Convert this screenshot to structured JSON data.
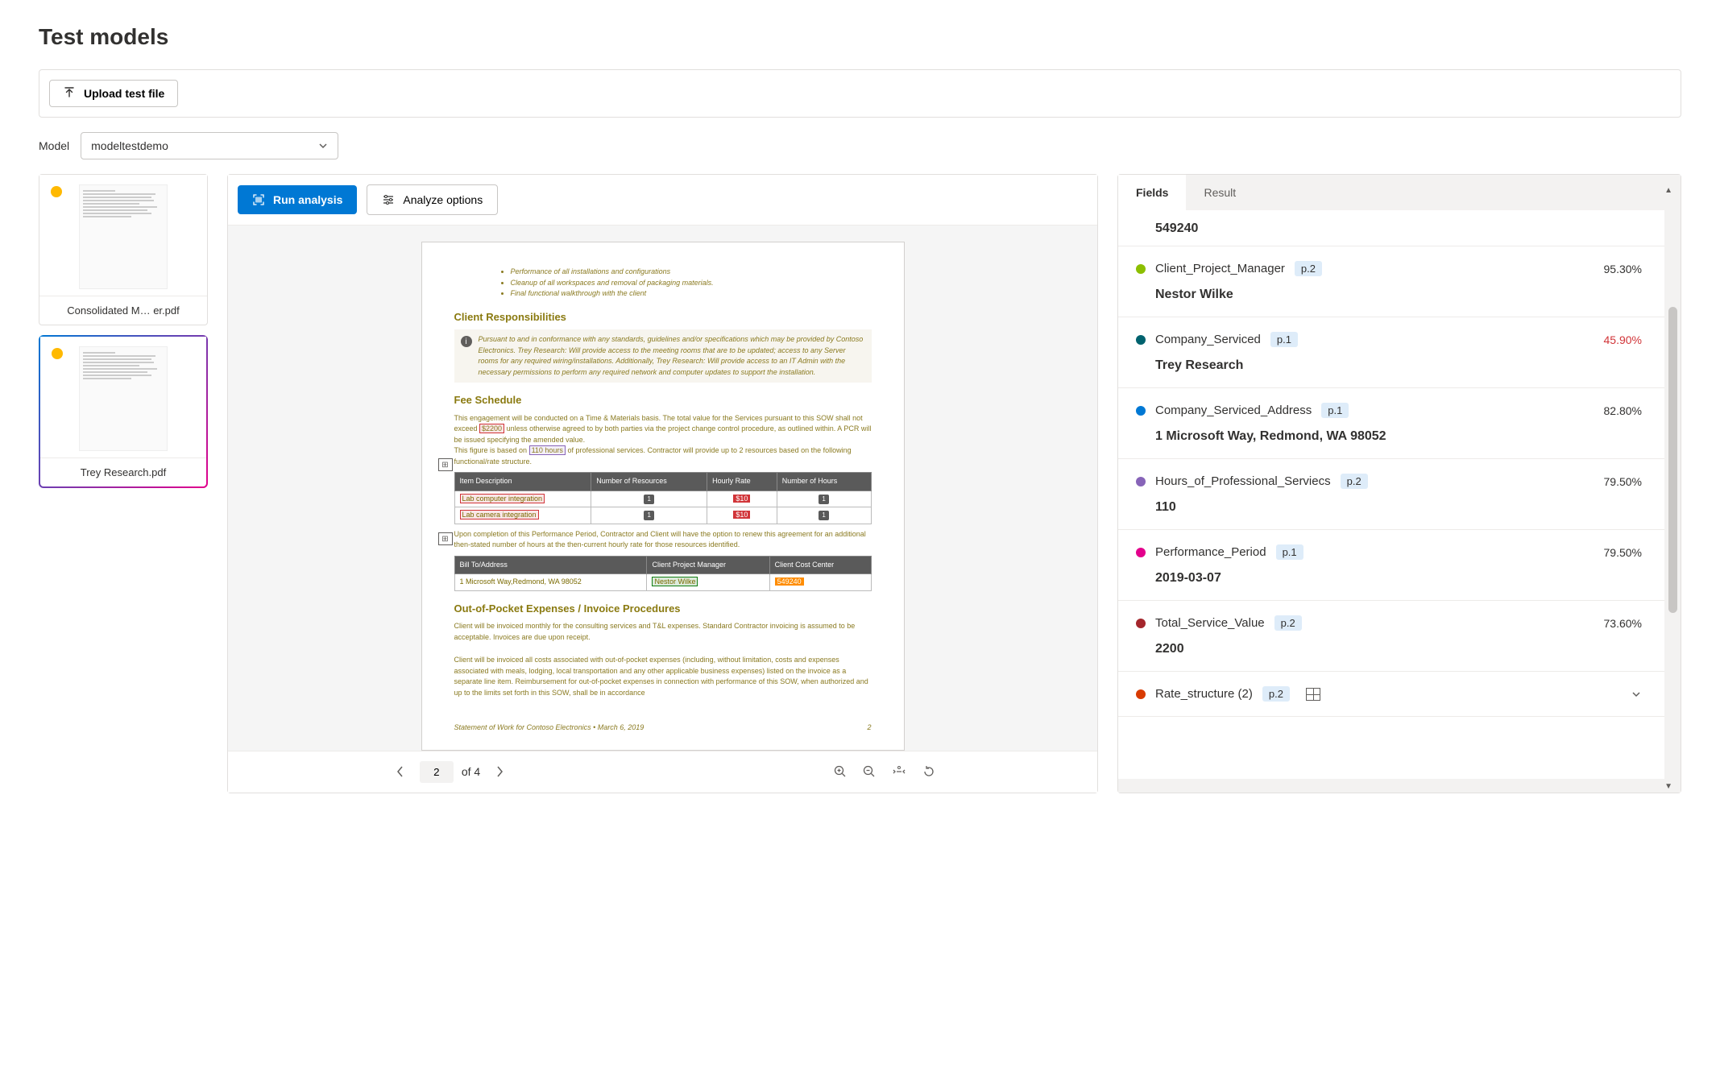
{
  "page_title": "Test models",
  "upload_button_label": "Upload test file",
  "model_label": "Model",
  "model_selected": "modeltestdemo",
  "run_analysis_label": "Run analysis",
  "analyze_options_label": "Analyze options",
  "files": [
    {
      "name": "Consolidated M… er.pdf",
      "selected": false
    },
    {
      "name": "Trey Research.pdf",
      "selected": true
    }
  ],
  "document": {
    "bullets": [
      "Performance of all installations and configurations",
      "Cleanup of all workspaces and removal of packaging materials.",
      "Final functional walkthrough with the client"
    ],
    "section_client_resp": "Client Responsibilities",
    "client_resp_body": "Pursuant to and in conformance with any standards, guidelines and/or specifications which may be provided by Contoso Electronics. Trey Research: Will provide access to the meeting rooms that are to be updated; access to any Server rooms for any required wiring/installations. Additionally, Trey Research: Will provide access to an IT Admin with the necessary permissions to perform any required network and computer updates to support the installation.",
    "section_fee": "Fee Schedule",
    "fee_body1_a": "This engagement will be conducted on a Time & Materials basis. The total value for the Services pursuant to this SOW shall not exceed ",
    "fee_total": "$2200",
    "fee_body1_b": " unless otherwise agreed to by both parties via the project change control procedure, as outlined within. A PCR will be issued specifying the amended value.",
    "fee_body2_a": "This figure is based on ",
    "fee_hours": "110 hours",
    "fee_body2_b": " of professional services. Contractor will provide up to 2 resources based on the following functional/rate structure.",
    "table1_headers": [
      "Item Description",
      "Number of Resources",
      "Hourly Rate",
      "Number of Hours"
    ],
    "table1_rows": [
      [
        "Lab computer integration",
        "1",
        "$10",
        "1"
      ],
      [
        "Lab camera integration",
        "1",
        "$10",
        "1"
      ]
    ],
    "fee_body3": "Upon completion of this Performance Period, Contractor and Client will have the option to renew this agreement for an additional then-stated number of hours at the then-current hourly rate for those resources identified.",
    "table2_headers": [
      "Bill To/Address",
      "Client Project Manager",
      "Client Cost Center"
    ],
    "table2_row": [
      "1 Microsoft Way,Redmond, WA 98052",
      "Nestor Wilke",
      "549240"
    ],
    "section_oop": "Out-of-Pocket Expenses / Invoice Procedures",
    "oop_body1": "Client will be invoiced monthly for the consulting services and T&L expenses. Standard Contractor invoicing is assumed to be acceptable. Invoices are due upon receipt.",
    "oop_body2": "Client will be invoiced all costs associated with out-of-pocket expenses (including, without limitation, costs and expenses associated with meals, lodging, local transportation and any other applicable business expenses) listed on the invoice as a separate line item. Reimbursement for out-of-pocket expenses in connection with performance of this SOW, when authorized and up to the limits set forth in this SOW, shall be in accordance",
    "footer_left": "Statement of Work for Contoso Electronics • March 6, 2019",
    "footer_right": "2"
  },
  "paging": {
    "current": "2",
    "of_label": "of 4"
  },
  "tabs": {
    "fields": "Fields",
    "result": "Result"
  },
  "top_value": "549240",
  "fields": [
    {
      "color": "#8cbf00",
      "name": "Client_Project_Manager",
      "page": "p.2",
      "conf": "95.30%",
      "value": "Nestor Wilke",
      "low": false
    },
    {
      "color": "#00626e",
      "name": "Company_Serviced",
      "page": "p.1",
      "conf": "45.90%",
      "value": "Trey Research",
      "low": true
    },
    {
      "color": "#0078d4",
      "name": "Company_Serviced_Address",
      "page": "p.1",
      "conf": "82.80%",
      "value": "1 Microsoft Way, Redmond, WA 98052",
      "low": false
    },
    {
      "color": "#8764b8",
      "name": "Hours_of_Professional_Serviecs",
      "page": "p.2",
      "conf": "79.50%",
      "value": "110",
      "low": false
    },
    {
      "color": "#e3008c",
      "name": "Performance_Period",
      "page": "p.1",
      "conf": "79.50%",
      "value": "2019-03-07",
      "low": false
    },
    {
      "color": "#a4262c",
      "name": "Total_Service_Value",
      "page": "p.2",
      "conf": "73.60%",
      "value": "2200",
      "low": false
    }
  ],
  "rate_structure": {
    "color": "#d83b01",
    "name": "Rate_structure (2)",
    "page": "p.2"
  }
}
